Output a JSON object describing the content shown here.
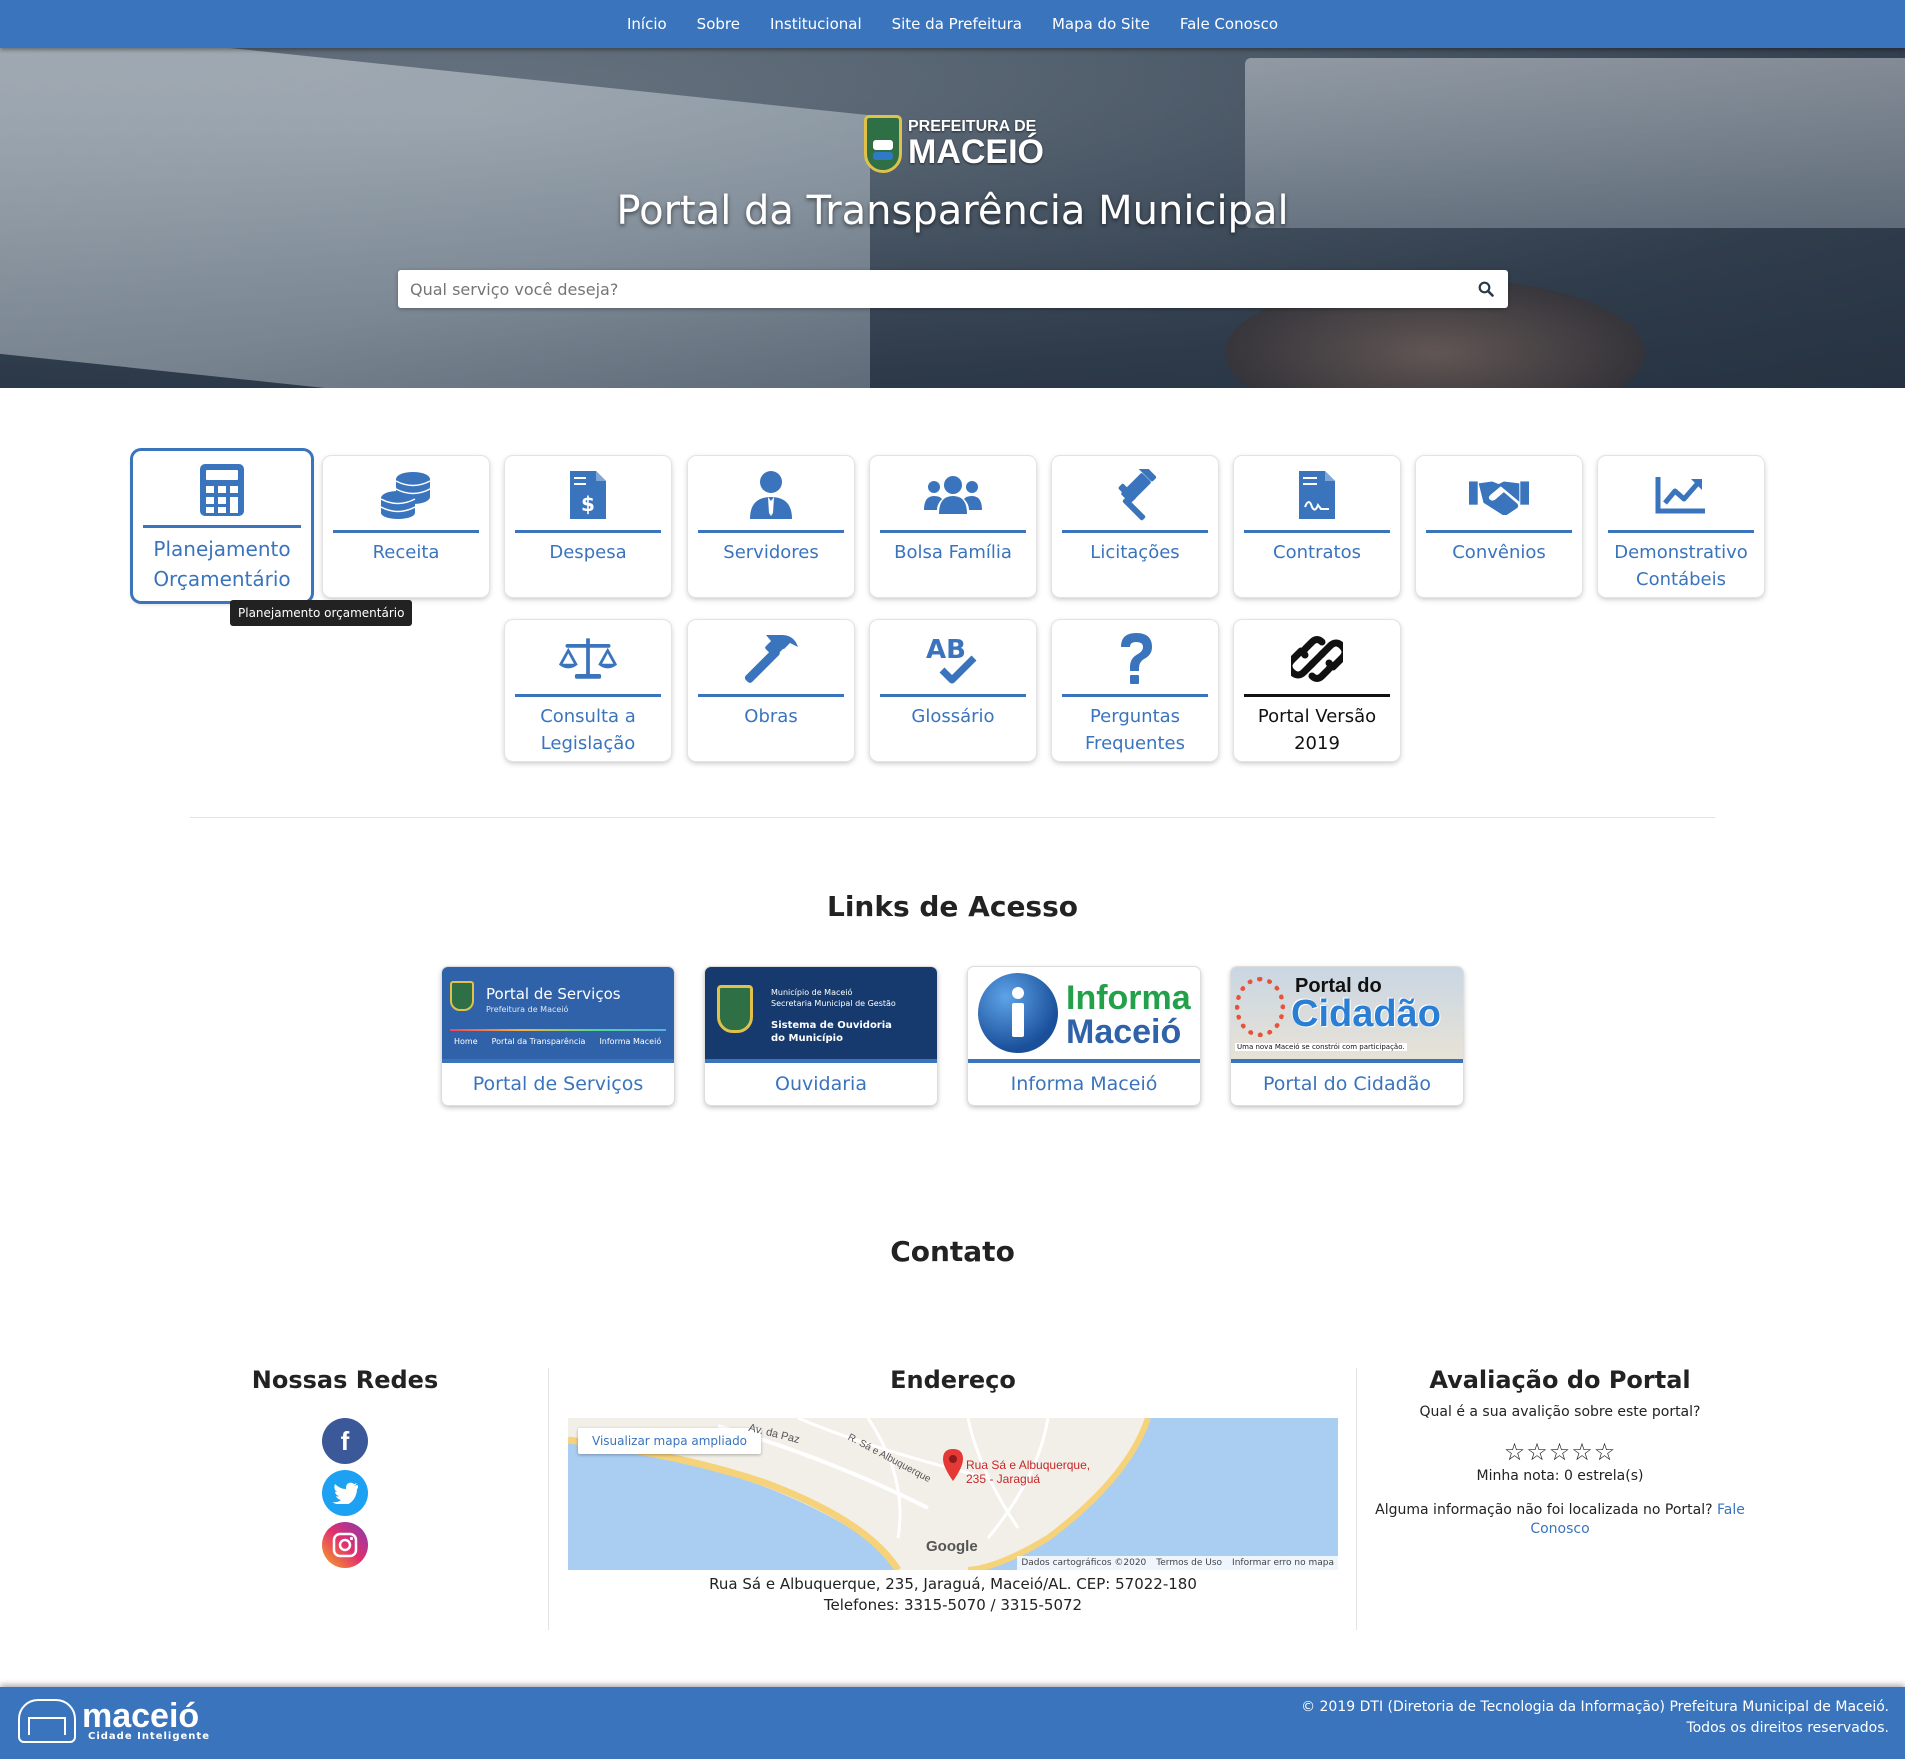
{
  "nav": [
    "Início",
    "Sobre",
    "Institucional",
    "Site da Prefeitura",
    "Mapa do Site",
    "Fale Conosco"
  ],
  "hero": {
    "logo_line1": "PREFEITURA DE",
    "logo_line2": "MACEIÓ",
    "title": "Portal da Transparência Municipal",
    "search_placeholder": "Qual serviço você deseja?"
  },
  "tiles": [
    {
      "label": "Planejamento Orçamentário",
      "icon": "calculator-icon"
    },
    {
      "label": "Receita",
      "icon": "coins-icon"
    },
    {
      "label": "Despesa",
      "icon": "invoice-dollar-icon"
    },
    {
      "label": "Servidores",
      "icon": "user-tie-icon"
    },
    {
      "label": "Bolsa Família",
      "icon": "users-icon"
    },
    {
      "label": "Licitações",
      "icon": "gavel-icon"
    },
    {
      "label": "Contratos",
      "icon": "file-contract-icon"
    },
    {
      "label": "Convênios",
      "icon": "handshake-icon"
    },
    {
      "label": "Demonstrativo Contábeis",
      "icon": "chart-line-icon"
    },
    {
      "label": "Consulta a Legislação",
      "icon": "balance-scale-icon"
    },
    {
      "label": "Obras",
      "icon": "hammer-icon"
    },
    {
      "label": "Glossário",
      "icon": "spell-check-icon"
    },
    {
      "label": "Perguntas Frequentes",
      "icon": "question-icon"
    },
    {
      "label": "Portal Versão 2019",
      "icon": "link-icon"
    }
  ],
  "tooltip": "Planejamento orçamentário",
  "links_title": "Links de Acesso",
  "links": [
    {
      "label": "Portal de Serviços",
      "banner_title": "Portal de Serviços",
      "banner_sub": "Prefeitura de Maceió",
      "banner_nav": [
        "Home",
        "Portal da Transparência",
        "Informa Maceió"
      ]
    },
    {
      "label": "Ouvidaria",
      "banner_line1": "Município de Maceió",
      "banner_line2": "Secretaria Municipal de Gestão",
      "banner_line3": "Sistema de Ouvidoria",
      "banner_line4": "do Município"
    },
    {
      "label": "Informa Maceió",
      "banner_line1": "Informa",
      "banner_line2": "Maceió"
    },
    {
      "label": "Portal do Cidadão",
      "banner_line1": "Portal do",
      "banner_line2": "Cidadão",
      "banner_line3": "Uma nova Maceió se constrói com participação."
    }
  ],
  "contato_title": "Contato",
  "redes": {
    "title": "Nossas Redes",
    "items": [
      "facebook-icon",
      "twitter-icon",
      "instagram-icon"
    ]
  },
  "endereco": {
    "title": "Endereço",
    "map_button": "Visualizar mapa ampliado",
    "pin_label_1": "Rua Sá e Albuquerque,",
    "pin_label_2": "235 - Jaraguá",
    "street_1": "Av. da Paz",
    "street_2": "R. Sá e Albuquerque",
    "google": "Google",
    "attrib": [
      "Dados cartográficos ©2020",
      "Termos de Uso",
      "Informar erro no mapa"
    ],
    "address": "Rua Sá e Albuquerque, 235, Jaraguá, Maceió/AL. CEP: 57022-180",
    "phones": "Telefones: 3315-5070 / 3315-5072"
  },
  "avaliacao": {
    "title": "Avaliação do Portal",
    "question": "Qual é a sua avalição sobre este portal?",
    "stars": "☆☆☆☆☆",
    "rating": 0,
    "note": "Minha nota: 0 estrela(s)",
    "missing_text": "Alguma informação não foi localizada no Portal?",
    "missing_link": "Fale Conosco"
  },
  "footer": {
    "brand": "maceió",
    "tagline": "Cidade Inteligente",
    "copy1": "© 2019 DTI (Diretoria de Tecnologia da Informação) Prefeitura Municipal de Maceió.",
    "copy2": "Todos os direitos reservados."
  },
  "colors": {
    "primary": "#3a74bd",
    "footer": "#3a74bd",
    "facebook": "#3b5998",
    "twitter": "#1da1f2",
    "instagram": "#c13584"
  }
}
